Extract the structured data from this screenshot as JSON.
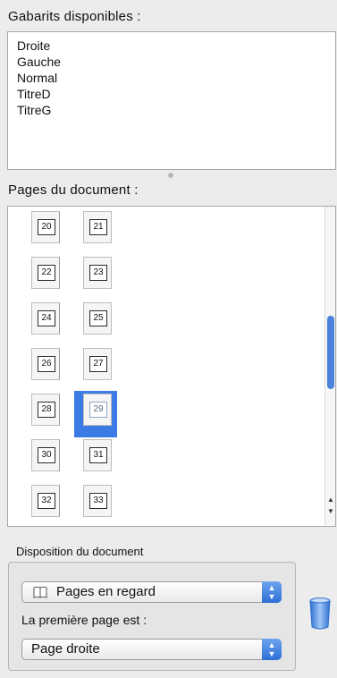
{
  "templates": {
    "label": "Gabarits disponibles :",
    "items": [
      "Droite",
      "Gauche",
      "Normal",
      "TitreD",
      "TitreG"
    ]
  },
  "pages": {
    "label": "Pages du document :",
    "left_pages": [
      "20",
      "22",
      "24",
      "26",
      "28",
      "30",
      "32"
    ],
    "right_pages": [
      "21",
      "23",
      "25",
      "27",
      "29",
      "31",
      "33"
    ],
    "selected_page": "29"
  },
  "layout": {
    "label": "Disposition du document",
    "layout_popup": {
      "value": "Pages en regard",
      "icon": "book-icon"
    },
    "first_page_label": "La première page est :",
    "first_page_popup": {
      "value": "Page droite"
    }
  },
  "icons": {
    "delete": "trash-icon",
    "stepper": "stepper-arrows-icon"
  },
  "colors": {
    "selection": "#3b7be3",
    "scroll_thumb": "#4a83d9",
    "stepper": "#2d6fd6"
  }
}
